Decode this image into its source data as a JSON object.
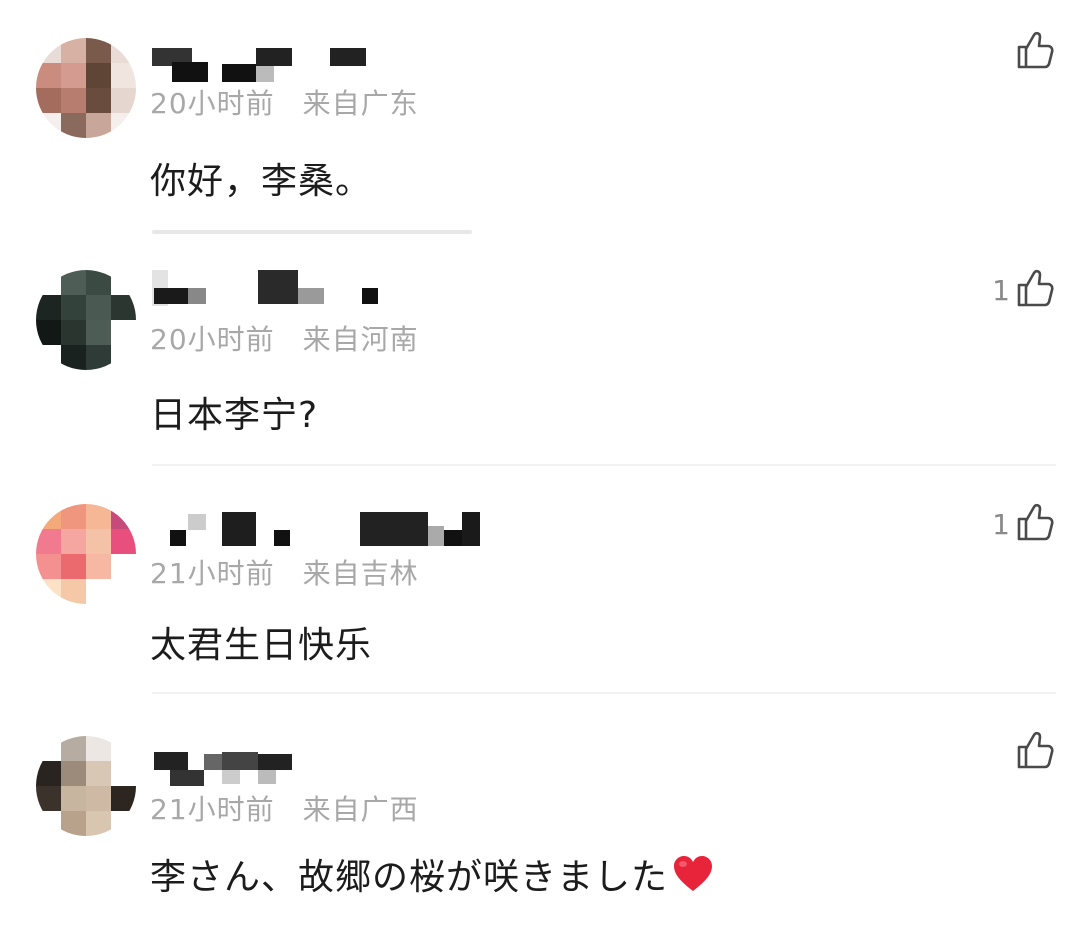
{
  "comments": [
    {
      "username": "",
      "time": "20小时前",
      "location": "来自广东",
      "text": "你好，李桑。",
      "likes": "",
      "avatar_colors": [
        "#e9dcd7",
        "#d7b2a4",
        "#7a5a4a",
        "#e9dcd7",
        "#c98c7e",
        "#d49c90",
        "#5e4536",
        "#f1e5e0",
        "#a46c5c",
        "#b77e70",
        "#6a4c3f",
        "#e6d6d0",
        "#f4eeec",
        "#8a6a5c",
        "#c8a79a",
        "#f4eeec"
      ]
    },
    {
      "username": "",
      "time": "20小时前",
      "location": "来自河南",
      "text": "日本李宁?",
      "likes": "1",
      "avatar_colors": [
        "#ffffff",
        "#4e5e56",
        "#3c4a44",
        "#ffffff",
        "#1c2522",
        "#34423c",
        "#4a5a52",
        "#2c3631",
        "#111815",
        "#2a3530",
        "#4d5c55",
        "#ffffff",
        "#ffffff",
        "#1a221f",
        "#2f3b36",
        "#ffffff"
      ]
    },
    {
      "username": "",
      "time": "21小时前",
      "location": "来自吉林",
      "text": "太君生日快乐",
      "likes": "1",
      "avatar_colors": [
        "#f4a97a",
        "#f0957e",
        "#f5b795",
        "#c64a7a",
        "#f27a8e",
        "#f6a6a0",
        "#f4c3a7",
        "#e84f7d",
        "#f49090",
        "#ea6a6e",
        "#f6b8a3",
        "#ffffff",
        "#fbe1c5",
        "#f5c9a8",
        "#ffffff",
        "#ffffff"
      ]
    },
    {
      "username": "",
      "time": "21小时前",
      "location": "来自广西",
      "text": "李さん、故郷の桜が咲きました",
      "likes": "",
      "avatar_colors": [
        "#ffffff",
        "#b6aca2",
        "#ece7e2",
        "#ffffff",
        "#2a2420",
        "#9c8a7a",
        "#d8c7b5",
        "#ffffff",
        "#3b322b",
        "#c8b59f",
        "#cdb9a4",
        "#2c2520",
        "#ffffff",
        "#b8a28c",
        "#d9c6b1",
        "#ffffff"
      ]
    }
  ],
  "icons": {
    "like": "thumb-up-outline-icon",
    "heart": "red-heart-emoji"
  },
  "colors": {
    "meta": "#a8a8a8",
    "text": "#1c1c1c",
    "heart": "#e8243a"
  }
}
